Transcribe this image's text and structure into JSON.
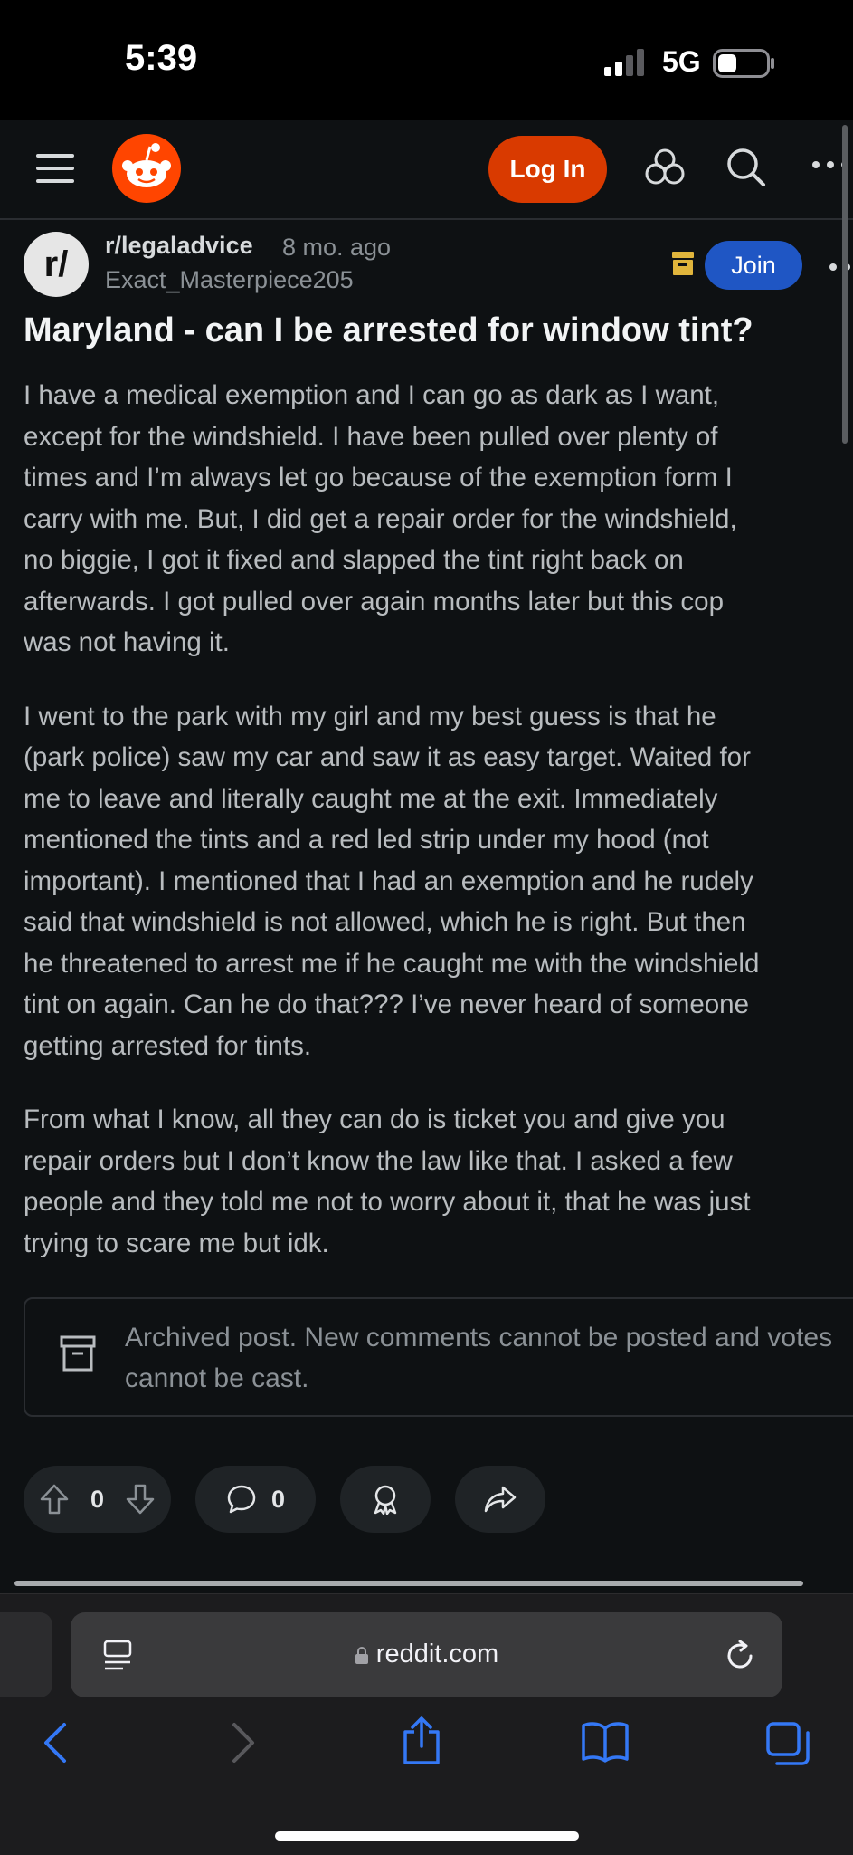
{
  "status": {
    "time": "5:39",
    "network": "5G"
  },
  "nav": {
    "login_label": "Log In"
  },
  "post": {
    "subreddit": "r/legaladvice",
    "subreddit_avatar": "r/",
    "age": "8 mo. ago",
    "author": "Exact_Masterpiece205",
    "join_label": "Join",
    "title": "Maryland - can I be arrested for window tint?",
    "paragraphs": [
      [
        "I have a medical exemption and I can go as dark as I want,",
        "except for the windshield. I have been pulled over plenty of",
        "times and I’m always let go because of the exemption form I",
        "carry with me. But, I did get a repair order for the windshield,",
        "no biggie, I got it fixed and slapped the tint right back on",
        "afterwards. I got pulled over again months later but this cop",
        "was not having it."
      ],
      [
        "I went to the park with my girl and my best guess is that he",
        "(park police) saw my car and saw it as easy target. Waited for",
        "me to leave and literally caught me at the exit. Immediately",
        "mentioned the tints and a red led strip under my hood (not",
        "important). I mentioned that I had an exemption and he rudely",
        "said that windshield is not allowed, which he is right. But then",
        "he threatened to arrest me if he caught me with the windshield",
        "tint on again. Can he do that??? I’ve never heard of someone",
        "getting arrested for tints."
      ],
      [
        "From what I know, all they can do is ticket you and give you",
        "repair orders but I don’t know the law like that. I asked a few",
        "people and they told me not to worry about it, that he was just",
        "trying to scare me but idk."
      ]
    ],
    "archived_notice": "Archived post. New comments cannot be posted and votes cannot be cast.",
    "votes": "0",
    "comments": "0"
  },
  "browser": {
    "url": "reddit.com"
  },
  "colors": {
    "accent_orange": "#d93a00",
    "join_blue": "#1f56c4",
    "ios_blue": "#3478f6",
    "background": "#0e1113"
  },
  "icons": [
    "menu-icon",
    "reddit-logo",
    "popular-icon",
    "search-icon",
    "more-icon",
    "archive-icon",
    "upvote-icon",
    "downvote-icon",
    "comment-icon",
    "award-icon",
    "share-icon",
    "tabs-icon",
    "lock-icon",
    "reload-icon",
    "back-icon",
    "forward-icon",
    "safari-share-icon",
    "bookmarks-icon",
    "safari-tabs-icon"
  ]
}
